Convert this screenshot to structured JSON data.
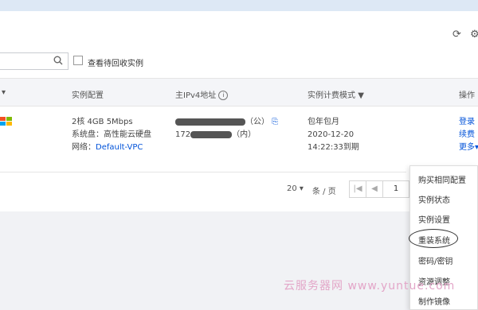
{
  "toolbar": {
    "refresh_icon": "refresh-icon",
    "settings_icon": "gear-icon"
  },
  "search": {
    "placeholder": ""
  },
  "filter": {
    "recycle_label": "查看待回收实例"
  },
  "table": {
    "headers": {
      "os_filter_icon": "filter-icon",
      "config": "实例配置",
      "ip": "主IPv4地址",
      "billing": "实例计费模式",
      "ops": "操作"
    },
    "row": {
      "cpu_mem_bw": "2核 4GB 5Mbps",
      "disk": "系统盘：高性能云硬盘",
      "network_label": "网络：",
      "network_value": "Default-VPC",
      "ip_public_suffix": "（公）",
      "ip_private_prefix": "172",
      "ip_private_suffix": "（内）",
      "billing_mode": "包年包月",
      "expire_date": "2020-12-20",
      "expire_time": "14:22:33到期",
      "op_login": "登录",
      "op_renew": "续费",
      "op_more": "更多"
    }
  },
  "pager": {
    "size": "20",
    "unit": "条 / 页",
    "page": "1"
  },
  "more_menu": {
    "items": [
      "购买相同配置",
      "实例状态",
      "实例设置",
      "重装系统",
      "密码/密钥",
      "资源调整",
      "制作镜像"
    ]
  },
  "watermark": "云服务器网 www.yuntue.com"
}
